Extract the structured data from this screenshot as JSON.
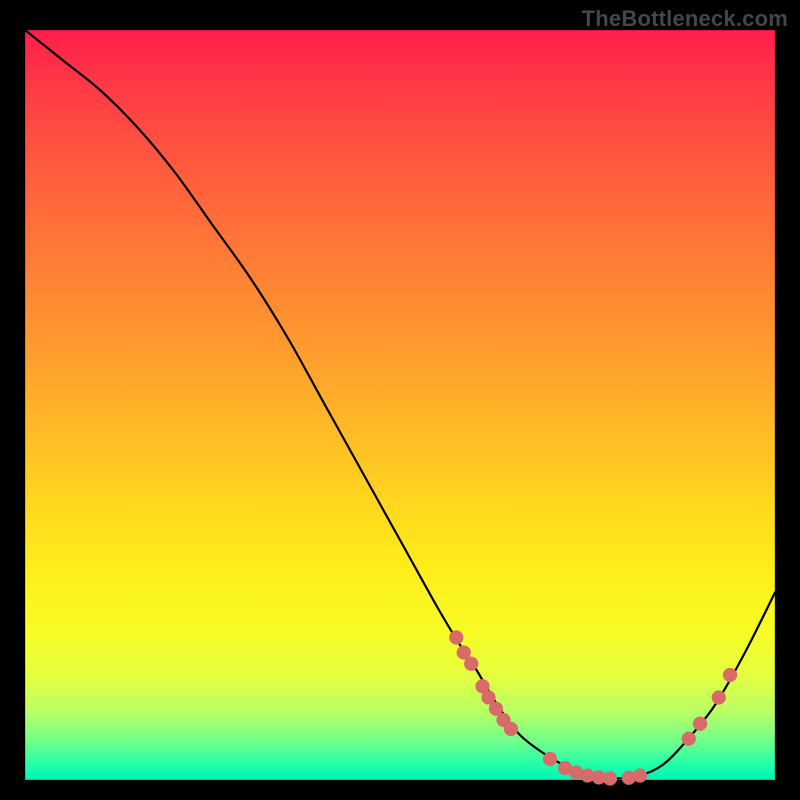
{
  "watermark": "TheBottleneck.com",
  "chart_data": {
    "type": "line",
    "title": "",
    "xlabel": "",
    "ylabel": "",
    "xlim": [
      0,
      100
    ],
    "ylim": [
      0,
      100
    ],
    "grid": false,
    "legend": false,
    "series": [
      {
        "name": "curve",
        "x": [
          0,
          5,
          10,
          15,
          20,
          25,
          30,
          35,
          40,
          45,
          50,
          55,
          58,
          60,
          63,
          66,
          70,
          73,
          76,
          79,
          82,
          85,
          88,
          92,
          96,
          100
        ],
        "y": [
          100,
          96,
          92,
          87,
          81,
          74,
          67,
          59,
          50,
          41,
          32,
          23,
          18,
          15,
          10,
          6,
          3,
          1.5,
          0.6,
          0.2,
          0.6,
          2,
          5,
          10,
          17,
          25
        ]
      }
    ],
    "points": [
      {
        "x": 57.5,
        "y": 19
      },
      {
        "x": 58.5,
        "y": 17
      },
      {
        "x": 59.5,
        "y": 15.5
      },
      {
        "x": 61.0,
        "y": 12.5
      },
      {
        "x": 61.8,
        "y": 11
      },
      {
        "x": 62.8,
        "y": 9.5
      },
      {
        "x": 63.8,
        "y": 8
      },
      {
        "x": 64.8,
        "y": 6.8
      },
      {
        "x": 70.0,
        "y": 2.8
      },
      {
        "x": 72.0,
        "y": 1.6
      },
      {
        "x": 73.5,
        "y": 1.0
      },
      {
        "x": 75.0,
        "y": 0.6
      },
      {
        "x": 76.5,
        "y": 0.35
      },
      {
        "x": 78.0,
        "y": 0.2
      },
      {
        "x": 80.5,
        "y": 0.3
      },
      {
        "x": 82.0,
        "y": 0.6
      },
      {
        "x": 88.5,
        "y": 5.5
      },
      {
        "x": 90.0,
        "y": 7.5
      },
      {
        "x": 92.5,
        "y": 11
      },
      {
        "x": 94.0,
        "y": 14
      }
    ],
    "colors": {
      "gradient_top": "#ff1f4a",
      "gradient_bottom": "#00f3b6",
      "line": "#000000",
      "point": "#d86a6a"
    }
  }
}
